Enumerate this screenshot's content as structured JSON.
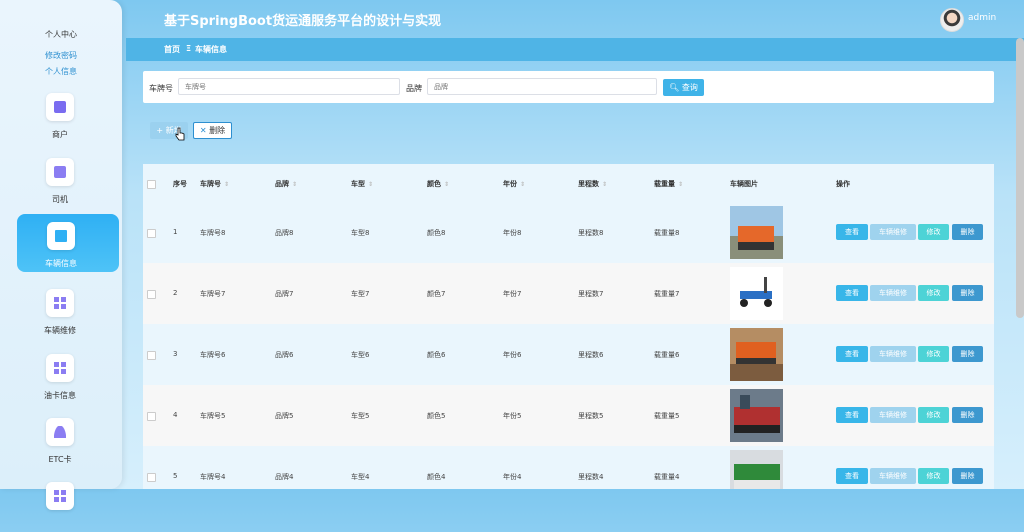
{
  "app": {
    "title": "基于SpringBoot货运通服务平台的设计与实现",
    "user": "admin"
  },
  "breadcrumb": {
    "home": "首页",
    "sep": "Ξ",
    "current": "车辆信息"
  },
  "sidebar": {
    "profile_title": "个人中心",
    "profile_links": [
      "修改密码",
      "个人信息"
    ],
    "items": [
      {
        "label": "商户",
        "icon": "briefcase-icon"
      },
      {
        "label": "司机",
        "icon": "clipboard-icon"
      },
      {
        "label": "车辆信息",
        "icon": "monitor-icon",
        "active": true
      },
      {
        "label": "车辆维修",
        "icon": "grid-icon"
      },
      {
        "label": "油卡信息",
        "icon": "grid-icon"
      },
      {
        "label": "ETC卡",
        "icon": "user-icon"
      }
    ]
  },
  "search": {
    "plate_label": "车牌号",
    "plate_placeholder": "车牌号",
    "brand_label": "品牌",
    "brand_placeholder": "品牌",
    "query_button": "查询"
  },
  "toolbar": {
    "add_button": "新增",
    "delete_button": "删除"
  },
  "table": {
    "columns": [
      "序号",
      "车牌号",
      "品牌",
      "车型",
      "颜色",
      "年份",
      "里程数",
      "载重量",
      "车辆图片",
      "操作"
    ],
    "rows": [
      {
        "no": "1",
        "plate": "车牌号8",
        "brand": "品牌8",
        "model": "车型8",
        "color": "颜色8",
        "year": "年份8",
        "mileage": "里程数8",
        "load": "载重量8"
      },
      {
        "no": "2",
        "plate": "车牌号7",
        "brand": "品牌7",
        "model": "车型7",
        "color": "颜色7",
        "year": "年份7",
        "mileage": "里程数7",
        "load": "载重量7"
      },
      {
        "no": "3",
        "plate": "车牌号6",
        "brand": "品牌6",
        "model": "车型6",
        "color": "颜色6",
        "year": "年份6",
        "mileage": "里程数6",
        "load": "载重量6"
      },
      {
        "no": "4",
        "plate": "车牌号5",
        "brand": "品牌5",
        "model": "车型5",
        "color": "颜色5",
        "year": "年份5",
        "mileage": "里程数5",
        "load": "载重量5"
      },
      {
        "no": "5",
        "plate": "车牌号4",
        "brand": "品牌4",
        "model": "车型4",
        "color": "颜色4",
        "year": "年份4",
        "mileage": "里程数4",
        "load": "载重量4"
      }
    ],
    "actions": {
      "view": "查看",
      "repair": "车辆维修",
      "edit": "修改",
      "delete": "删除"
    }
  },
  "colors": {
    "accent": "#3fb3e8",
    "header_bar": "#4fb4e6",
    "active_nav": "#2fb0f4"
  }
}
